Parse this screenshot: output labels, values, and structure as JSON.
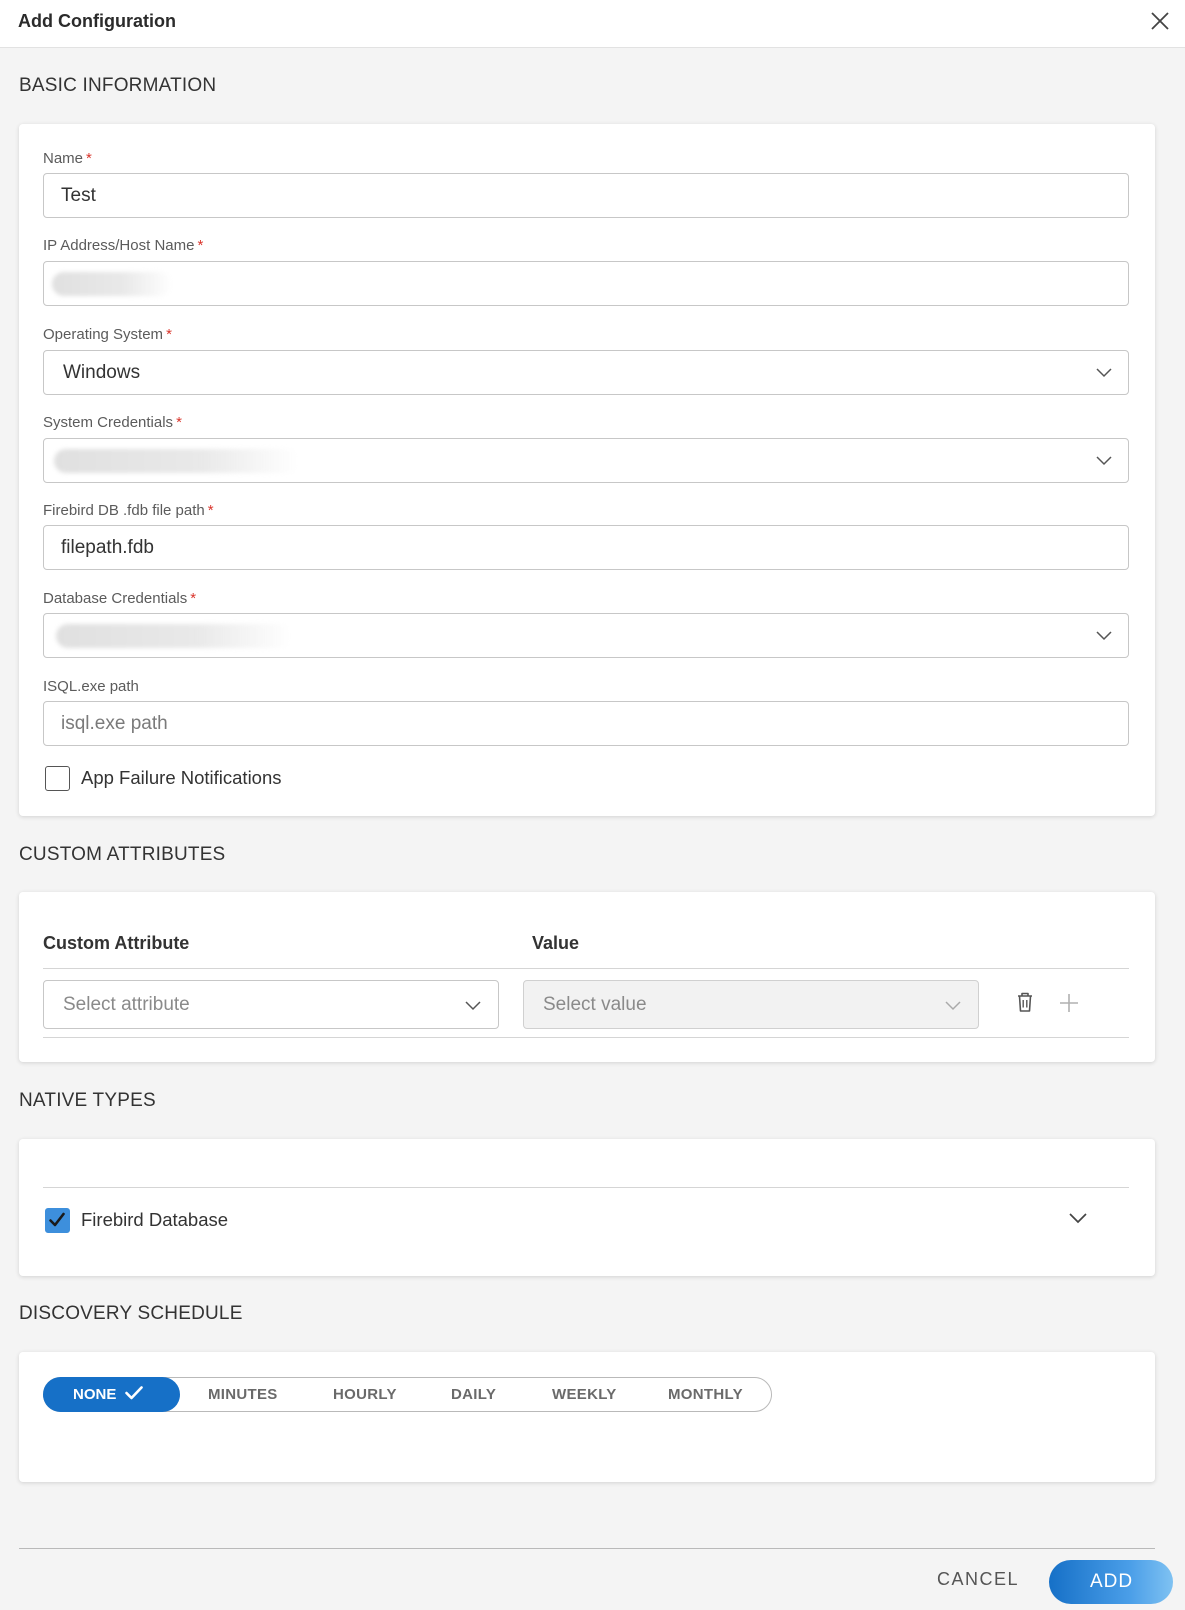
{
  "dialog": {
    "title": "Add Configuration"
  },
  "basic": {
    "section_title": "BASIC INFORMATION",
    "name": {
      "label": "Name",
      "value": "Test"
    },
    "ip": {
      "label": "IP Address/Host Name"
    },
    "os": {
      "label": "Operating System",
      "value": "Windows"
    },
    "syscred": {
      "label": "System Credentials"
    },
    "fdb": {
      "label": "Firebird DB .fdb file path",
      "value": "filepath.fdb"
    },
    "dbcred": {
      "label": "Database Credentials"
    },
    "isql": {
      "label": "ISQL.exe path",
      "placeholder": "isql.exe path"
    },
    "app_failure": {
      "label": "App Failure Notifications",
      "checked": false
    },
    "required_mark": "*"
  },
  "custom": {
    "section_title": "CUSTOM ATTRIBUTES",
    "col_attribute": "Custom Attribute",
    "col_value": "Value",
    "attr_placeholder": "Select attribute",
    "value_placeholder": "Select value"
  },
  "native": {
    "section_title": "NATIVE TYPES",
    "item_label": "Firebird Database",
    "item_checked": true
  },
  "schedule": {
    "section_title": "DISCOVERY SCHEDULE",
    "options": [
      "NONE",
      "MINUTES",
      "HOURLY",
      "DAILY",
      "WEEKLY",
      "MONTHLY"
    ],
    "selected": "NONE"
  },
  "footer": {
    "cancel": "CANCEL",
    "add": "ADD"
  },
  "colors": {
    "accent": "#1670c7",
    "required": "#d9342b",
    "checkbox": "#3d8fdc"
  }
}
